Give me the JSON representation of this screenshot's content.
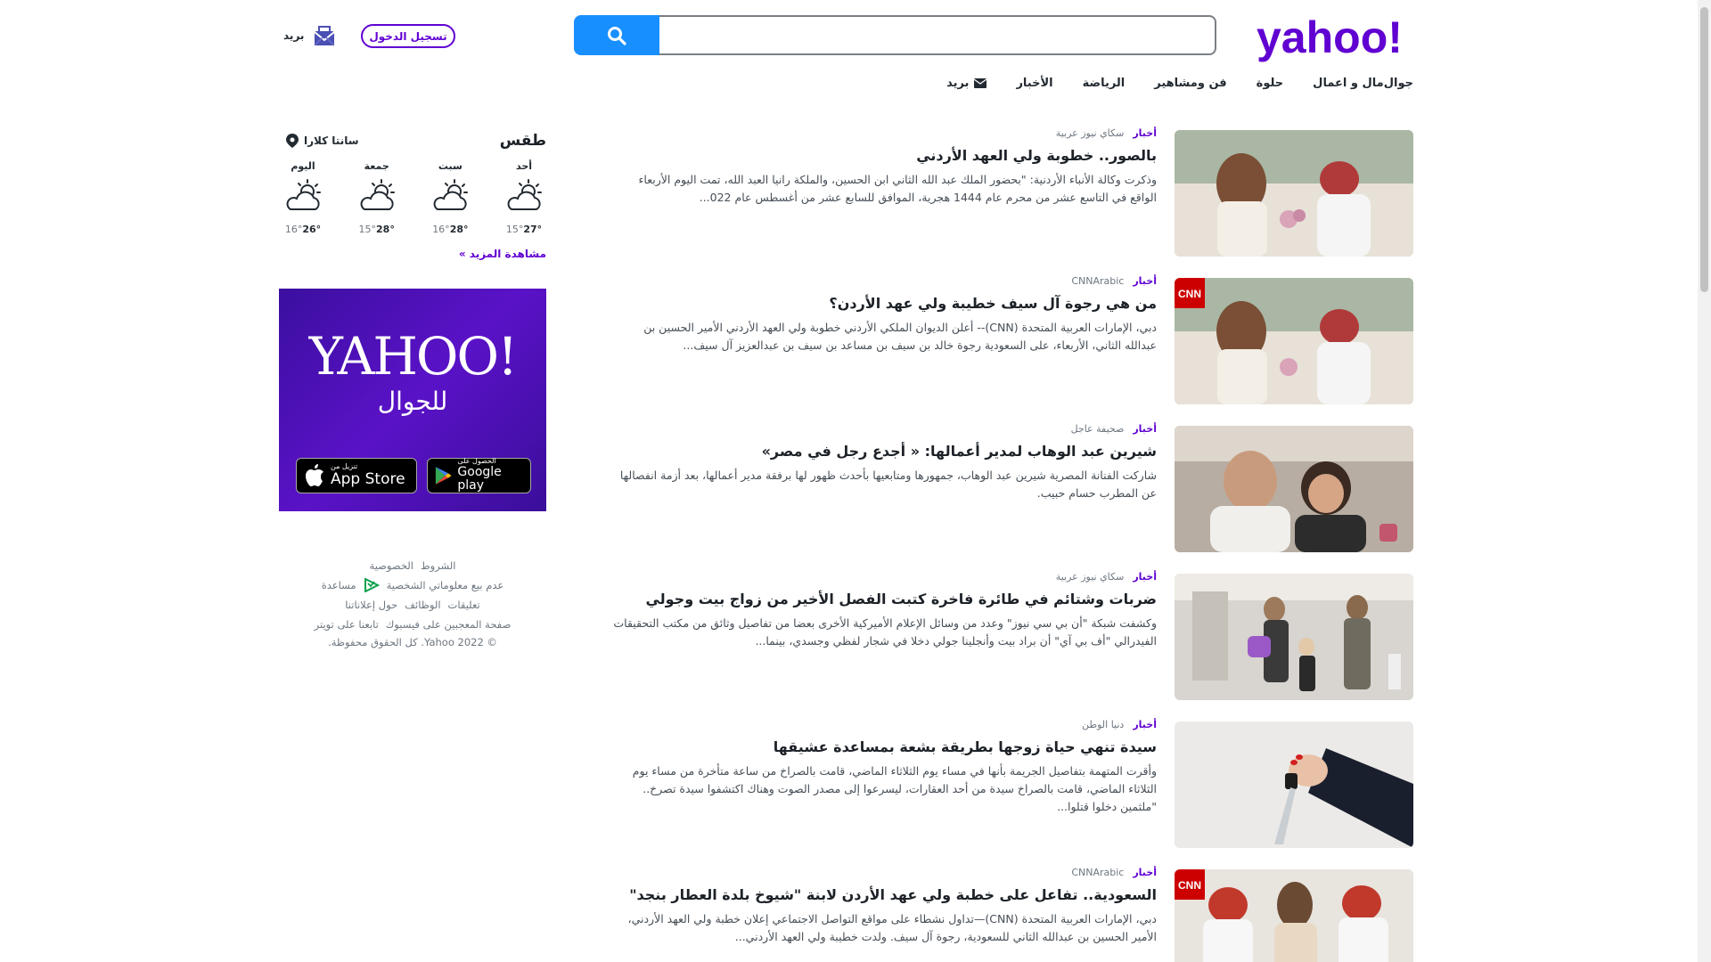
{
  "header": {
    "logo_text": "yahoo!",
    "search": {
      "placeholder": "",
      "value": ""
    },
    "login_label": "تسجيل الدخول",
    "mail_label": "بريد"
  },
  "nav": [
    {
      "label": "بريد",
      "icon": "mail-icon"
    },
    {
      "label": "الأخبار"
    },
    {
      "label": "الرياضة"
    },
    {
      "label": "فن ومشاهير"
    },
    {
      "label": "حلوة"
    },
    {
      "label": "مال و اعمال"
    },
    {
      "label": "جوال"
    }
  ],
  "stories": [
    {
      "category": "أخبار",
      "source": "سكاي نيوز عربية",
      "headline": "بالصور.. خطوبة ولي العهد الأردني",
      "summary": "وذكرت وكالة الأنباء الأردنية: \"بحضور الملك عبد الله الثاني ابن الحسين، والملكة رانيا العبد الله، تمت اليوم الأربعاء الواقع في التاسع عشر من محرم عام 1444 هجرية، الموافق للسابع عشر من أغسطس عام 022...",
      "image": "engagement-photo"
    },
    {
      "category": "أخبار",
      "source": "CNNArabic",
      "headline": "من هي رجوة آل سيف خطيبة ولي عهد الأردن؟",
      "summary": "دبي، الإمارات العربية المتحدة (CNN)-- أعلن الديوان الملكي الأردني خطوبة ولي العهد الأردني الأمير الحسين بن عبدالله الثاني، الأربعاء، على السعودية رجوة خالد بن سيف بن مساعد بن سيف بن عبدالعزيز آل سيف...",
      "image": "engagement-photo-cnn",
      "badge": "CNN"
    },
    {
      "category": "أخبار",
      "source": "صحيفة عاجل",
      "headline": "شيرين عبد الوهاب لمدير أعمالها: « أجدع رجل في مصر»",
      "summary": "شاركت الفنانة المصرية شيرين عبد الوهاب، جمهورها ومتابعيها بأحدث ظهور لها برفقة مدير أعمالها، بعد أزمة انفصالها عن المطرب حسام حبيب.",
      "image": "selfie-photo"
    },
    {
      "category": "أخبار",
      "source": "سكاي نيوز عربية",
      "headline": "ضربات وشتائم في طائرة فاخرة كتبت الفصل الأخير من زواج بيت وجولي",
      "summary": "وكشفت شبكة \"أن بي سي نيوز\" وعدد من وسائل الإعلام الأميركية الأخرى بعضا من تفاصيل وثائق من مكتب التحقيقات الفيدرالي \"أف بي آي\" أن براد بيت وأنجلينا جولي دخلا في شجار لفظي وجسدي، بينما...",
      "image": "airport-photo"
    },
    {
      "category": "أخبار",
      "source": "دنيا الوطن",
      "headline": "سيدة تنهي حياة زوجها بطريقة بشعة بمساعدة عشيقها",
      "summary": "وأقرت المتهمة بتفاصيل الجريمة بأنها في مساء يوم الثلاثاء الماضي، قامت بالصراخ من ساعة متأخرة من مساء يوم الثلاثاء الماضي، قامت بالصراخ سيدة من أحد العقارات، ليسرعوا إلى مصدر الصوت وهناك اكتشفوا سيدة تصرخ.. \"ملثمين دخلوا قتلوا...",
      "image": "knife-photo"
    },
    {
      "category": "أخبار",
      "source": "CNNArabic",
      "headline": "السعودية.. تفاعل على خطبة ولي عهد الأردن لابنة \"شيوخ بلدة العطار بنجد\"",
      "summary": "دبي، الإمارات العربية المتحدة (CNN)—تداول نشطاء على مواقع التواصل الاجتماعي إعلان خطبة ولي العهد الأردني، الأمير الحسين بن عبدالله الثاني للسعودية، رجوة آل سيف. ولدت خطيبة ولي العهد الأردني...",
      "image": "royal-photo-cnn",
      "badge": "CNN"
    }
  ],
  "weather": {
    "title": "طقس",
    "location": "سانتا كلارا",
    "days": [
      {
        "name": "اليوم",
        "hi": "26°",
        "lo": "16°"
      },
      {
        "name": "جمعة",
        "hi": "28°",
        "lo": "15°"
      },
      {
        "name": "سبت",
        "hi": "28°",
        "lo": "16°"
      },
      {
        "name": "أحد",
        "hi": "27°",
        "lo": "15°"
      }
    ],
    "more_label": "مشاهدة المزيد »"
  },
  "ad": {
    "logo": "YAHOO!",
    "subtitle": "للجوال",
    "google_small": "الحصول على",
    "google_big": "Google play",
    "apple_small": "تنزيل من",
    "apple_big": "App Store"
  },
  "footer": {
    "terms": "الشروط",
    "privacy": "الخصوصية",
    "do_not_sell": "عدم بيع معلوماتي الشخصية",
    "help": "مساعدة",
    "comments": "تعليقات",
    "jobs": "الوظائف",
    "ads": "حول إعلاناتنا",
    "facebook": "صفحة المعجبين على فيسبوك",
    "twitter": "تابعنا على تويتر",
    "copyright": "© Yahoo 2022. كل الحقوق محفوظة."
  },
  "colors": {
    "brand": "#6001d2",
    "search_button": "#188fff"
  }
}
